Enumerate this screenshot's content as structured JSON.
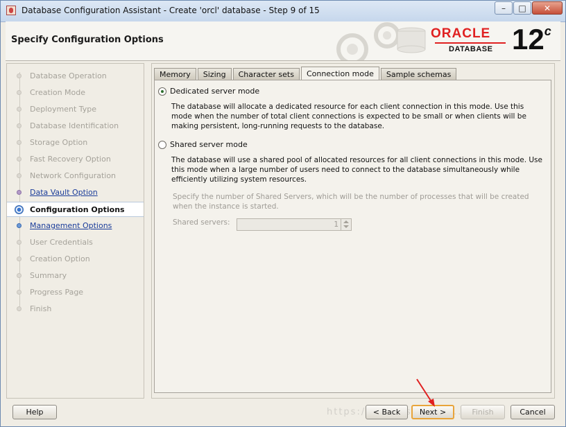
{
  "window": {
    "title": "Database Configuration Assistant - Create 'orcl' database - Step 9 of 15"
  },
  "window_controls": {
    "minimize": "–",
    "maximize": "□",
    "close": "✕"
  },
  "header": {
    "page_title": "Specify Configuration Options",
    "logo_brand": "ORACLE",
    "logo_product": "DATABASE",
    "logo_version": "12",
    "logo_version_suffix": "c"
  },
  "steps": [
    {
      "label": "Database Operation",
      "state": "done"
    },
    {
      "label": "Creation Mode",
      "state": "done"
    },
    {
      "label": "Deployment Type",
      "state": "done"
    },
    {
      "label": "Database Identification",
      "state": "done"
    },
    {
      "label": "Storage Option",
      "state": "done"
    },
    {
      "label": "Fast Recovery Option",
      "state": "done"
    },
    {
      "label": "Network Configuration",
      "state": "done"
    },
    {
      "label": "Data Vault Option",
      "state": "link"
    },
    {
      "label": "Configuration Options",
      "state": "current"
    },
    {
      "label": "Management Options",
      "state": "link"
    },
    {
      "label": "User Credentials",
      "state": "todo"
    },
    {
      "label": "Creation Option",
      "state": "todo"
    },
    {
      "label": "Summary",
      "state": "todo"
    },
    {
      "label": "Progress Page",
      "state": "todo"
    },
    {
      "label": "Finish",
      "state": "todo"
    }
  ],
  "tabs": [
    {
      "label": "Memory",
      "selected": false
    },
    {
      "label": "Sizing",
      "selected": false
    },
    {
      "label": "Character sets",
      "selected": false
    },
    {
      "label": "Connection mode",
      "selected": true
    },
    {
      "label": "Sample schemas",
      "selected": false
    }
  ],
  "connection_mode": {
    "dedicated": {
      "label": "Dedicated server mode",
      "checked": true,
      "description": "The database will allocate a dedicated resource for each client connection in this mode. Use this mode when the number of total client connections is expected to be small or when clients will be making persistent, long-running requests to the database."
    },
    "shared": {
      "label": "Shared server mode",
      "checked": false,
      "description": "The database will use a shared pool of allocated resources for all client connections in this mode. Use this mode when a large number of users need to connect to the database simultaneously while efficiently utilizing system resources."
    },
    "shared_servers_hint": "Specify the number of Shared Servers, which will be the number of processes that will be created when the instance is started.",
    "shared_servers_label": "Shared servers:",
    "shared_servers_value": "1"
  },
  "buttons": {
    "help": "Help",
    "back": "< Back",
    "next": "Next >",
    "finish": "Finish",
    "cancel": "Cancel"
  },
  "watermark": "https://blog.csdn.net/..."
}
